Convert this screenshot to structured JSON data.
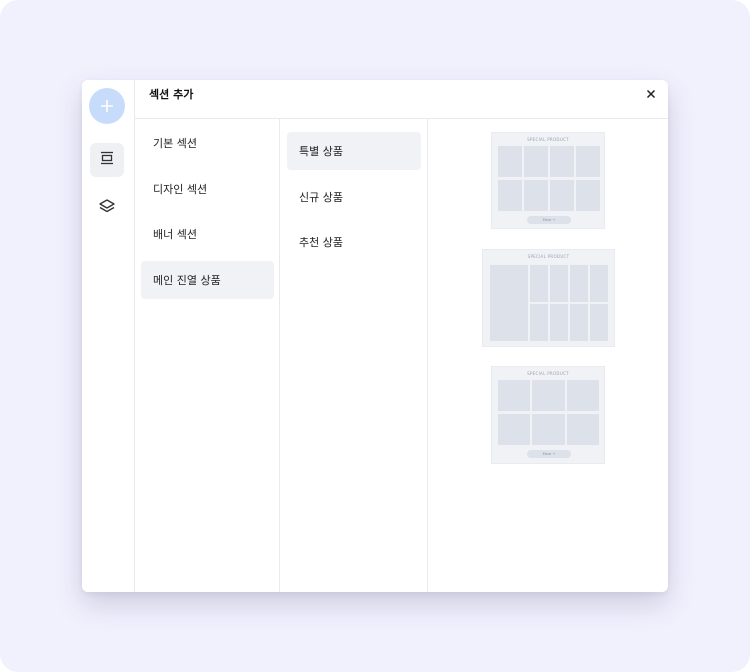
{
  "dialog": {
    "title": "섹션 추가",
    "close_icon": "close-icon"
  },
  "rail": {
    "add_icon": "plus-icon",
    "items": [
      {
        "icon": "section-layout-icon",
        "active": true
      },
      {
        "icon": "layers-icon",
        "active": false
      }
    ]
  },
  "categories": [
    {
      "label": "기본 섹션",
      "selected": false
    },
    {
      "label": "디자인 섹션",
      "selected": false
    },
    {
      "label": "배너 섹션",
      "selected": false
    },
    {
      "label": "메인 진열 상품",
      "selected": true
    }
  ],
  "subcategories": [
    {
      "label": "특별 상품",
      "selected": true
    },
    {
      "label": "신규 상품",
      "selected": false
    },
    {
      "label": "추천 상품",
      "selected": false
    }
  ],
  "previews": [
    {
      "caption": "SPECIAL PRODUCT",
      "button": "More →"
    },
    {
      "caption": "SPECIAL PRODUCT"
    },
    {
      "caption": "SPECIAL PRODUCT",
      "button": "More →"
    }
  ]
}
